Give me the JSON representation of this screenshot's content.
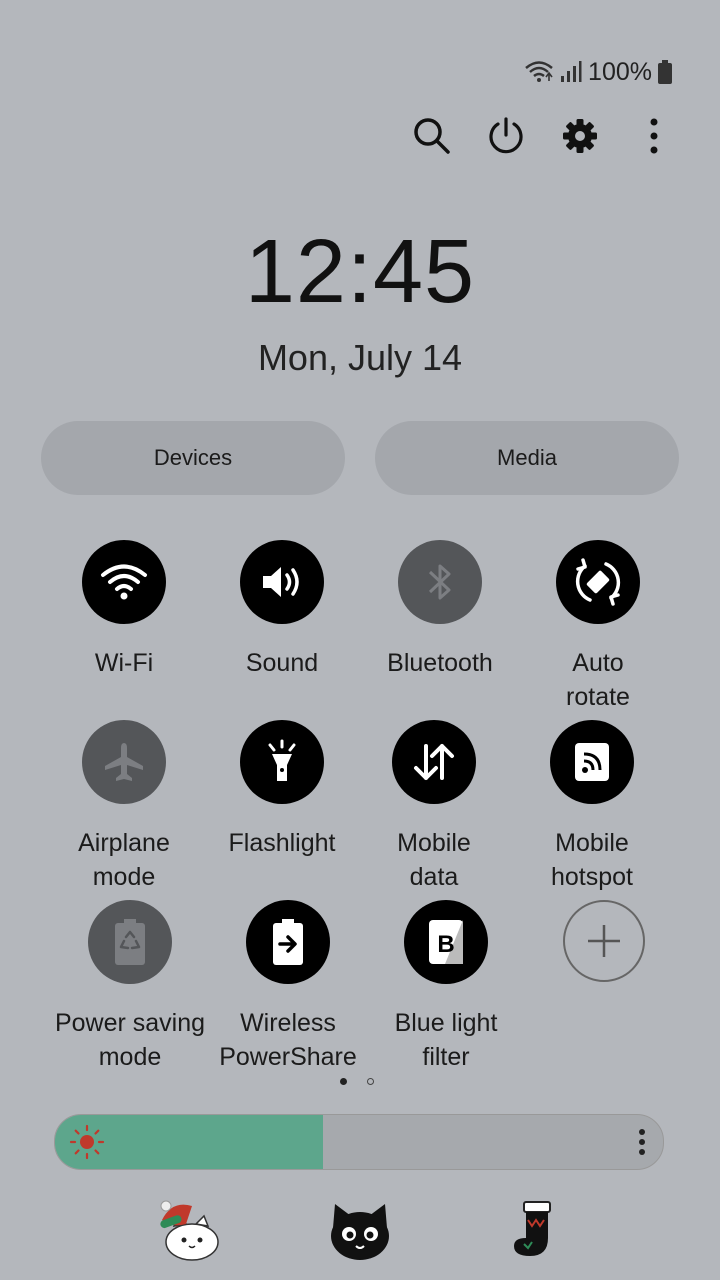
{
  "status_bar": {
    "battery_text": "100%",
    "icons": [
      "wifi-icon",
      "signal-icon",
      "battery-icon"
    ]
  },
  "top_actions": [
    "search-icon",
    "power-icon",
    "settings-icon",
    "more-icon"
  ],
  "clock": {
    "time": "12:45",
    "date": "Mon, July 14"
  },
  "pills": {
    "devices": "Devices",
    "media": "Media"
  },
  "tiles": [
    {
      "label": "Wi-Fi",
      "state": "on",
      "icon": "wifi-icon"
    },
    {
      "label": "Sound",
      "state": "on",
      "icon": "sound-icon"
    },
    {
      "label": "Bluetooth",
      "state": "off",
      "icon": "bluetooth-icon"
    },
    {
      "label": "Auto\nrotate",
      "state": "on",
      "icon": "auto-rotate-icon"
    },
    {
      "label": "Airplane\nmode",
      "state": "off",
      "icon": "airplane-icon"
    },
    {
      "label": "Flashlight",
      "state": "on",
      "icon": "flashlight-icon"
    },
    {
      "label": "Mobile\ndata",
      "state": "on",
      "icon": "mobile-data-icon"
    },
    {
      "label": "Mobile\nhotspot",
      "state": "on",
      "icon": "hotspot-icon"
    },
    {
      "label": "Power saving\nmode",
      "state": "off",
      "icon": "power-saving-icon"
    },
    {
      "label": "Wireless\nPowerShare",
      "state": "on",
      "icon": "wireless-powershare-icon"
    },
    {
      "label": "Blue light\nfilter",
      "state": "on",
      "icon": "blue-light-filter-icon"
    },
    {
      "label": "",
      "state": "add",
      "icon": "add-icon"
    }
  ],
  "pages": {
    "current": 1,
    "total": 2
  },
  "brightness": {
    "level": 0.44,
    "fill_color": "#5da68c"
  },
  "stickers": [
    "cat-with-hat-sticker",
    "black-cat-sticker",
    "christmas-stocking-sticker"
  ],
  "colors": {
    "background": "#b4b7bc",
    "tile_on": "#000000",
    "tile_off": "#545659",
    "pill_bg": "#a4a7ac"
  }
}
